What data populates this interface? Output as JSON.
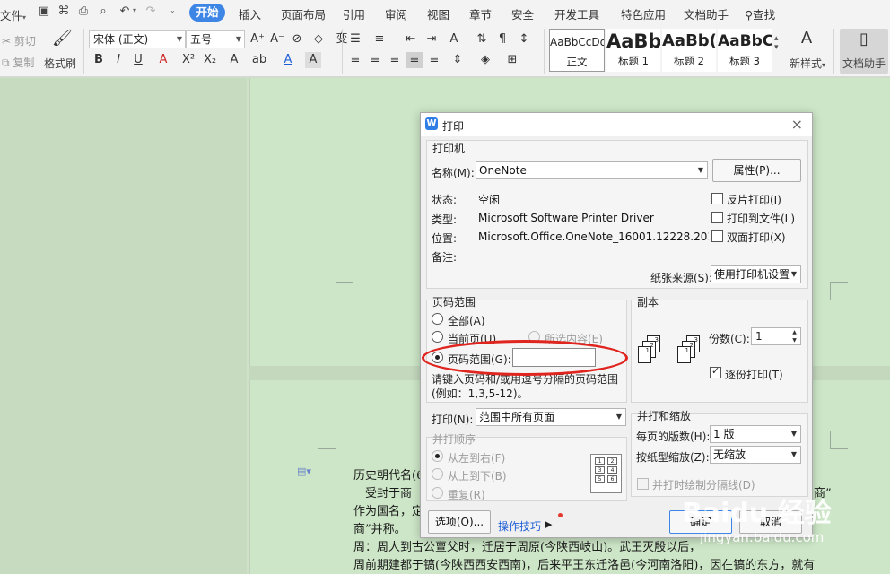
{
  "menubar": {
    "file_label": "文件",
    "tabs": [
      "开始",
      "插入",
      "页面布局",
      "引用",
      "审阅",
      "视图",
      "章节",
      "安全",
      "开发工具",
      "特色应用",
      "文档助手"
    ],
    "active_tab": "开始",
    "search_label": "查找"
  },
  "ribbon": {
    "cut": "剪切",
    "copy": "复制",
    "format_painter": "格式刷",
    "font_name": "宋体 (正文)",
    "font_size": "五号",
    "styles": [
      {
        "sample": "AaBbCcDd",
        "label": "正文"
      },
      {
        "sample": "AaBb",
        "label": "标题 1"
      },
      {
        "sample": "AaBb(",
        "label": "标题 2"
      },
      {
        "sample": "AaBbC",
        "label": "标题 3"
      }
    ],
    "new_style": "新样式",
    "doc_assistant": "文档助手"
  },
  "document": {
    "lines": [
      "历史朝代名(6",
      "　受封于商（",
      "作为国名，定",
      "商”并称。",
      "周：周人到古公亶父时，迁居于周原(今陕西岐山)。武王灭殷以后，",
      "周前期建都于镐(今陕西西安西南)，后来平王东迁洛邑(今河南洛阳)，因在镐的东方，就有"
    ],
    "line1_tail": "商”"
  },
  "dialog": {
    "title": "打印",
    "printer_group": "打印机",
    "name_label": "名称(M):",
    "name_value": "OneNote",
    "properties_btn": "属性(P)...",
    "status_label": "状态:",
    "status_value": "空闲",
    "type_label": "类型:",
    "type_value": "Microsoft Software Printer Driver",
    "location_label": "位置:",
    "location_value": "Microsoft.Office.OneNote_16001.12228.20184",
    "comment_label": "备注:",
    "reverse_print": "反片打印(I)",
    "print_to_file": "打印到文件(L)",
    "duplex": "双面打印(X)",
    "paper_source_label": "纸张来源(S):",
    "paper_source_value": "使用打印机设置",
    "range_group": "页码范围",
    "all_pages": "全部(A)",
    "current_page": "当前页(U)",
    "selection": "所选内容(E)",
    "page_range": "页码范围(G):",
    "page_range_value": "",
    "range_hint_1": "请键入页码和/或用逗号分隔的页码范围",
    "range_hint_2": "(例如：1,3,5-12)。",
    "copies_group": "副本",
    "copies_label": "份数(C):",
    "copies_value": "1",
    "collate": "逐份打印(T)",
    "print_label": "打印(N):",
    "print_value": "范围中所有页面",
    "order_group": "并打顺序",
    "left_to_right": "从左到右(F)",
    "top_to_bottom": "从上到下(B)",
    "repeat": "重复(R)",
    "zoom_group": "并打和缩放",
    "pages_per_sheet_label": "每页的版数(H):",
    "pages_per_sheet_value": "1 版",
    "scale_label": "按纸型缩放(Z):",
    "scale_value": "无缩放",
    "draw_borders": "并打时绘制分隔线(D)",
    "options_btn": "选项(O)...",
    "tips_link": "操作技巧",
    "ok_btn": "确定",
    "cancel_btn": "取消"
  },
  "watermark": {
    "logo": "Baidu 经验",
    "url": "jingyan.baidu.com"
  }
}
